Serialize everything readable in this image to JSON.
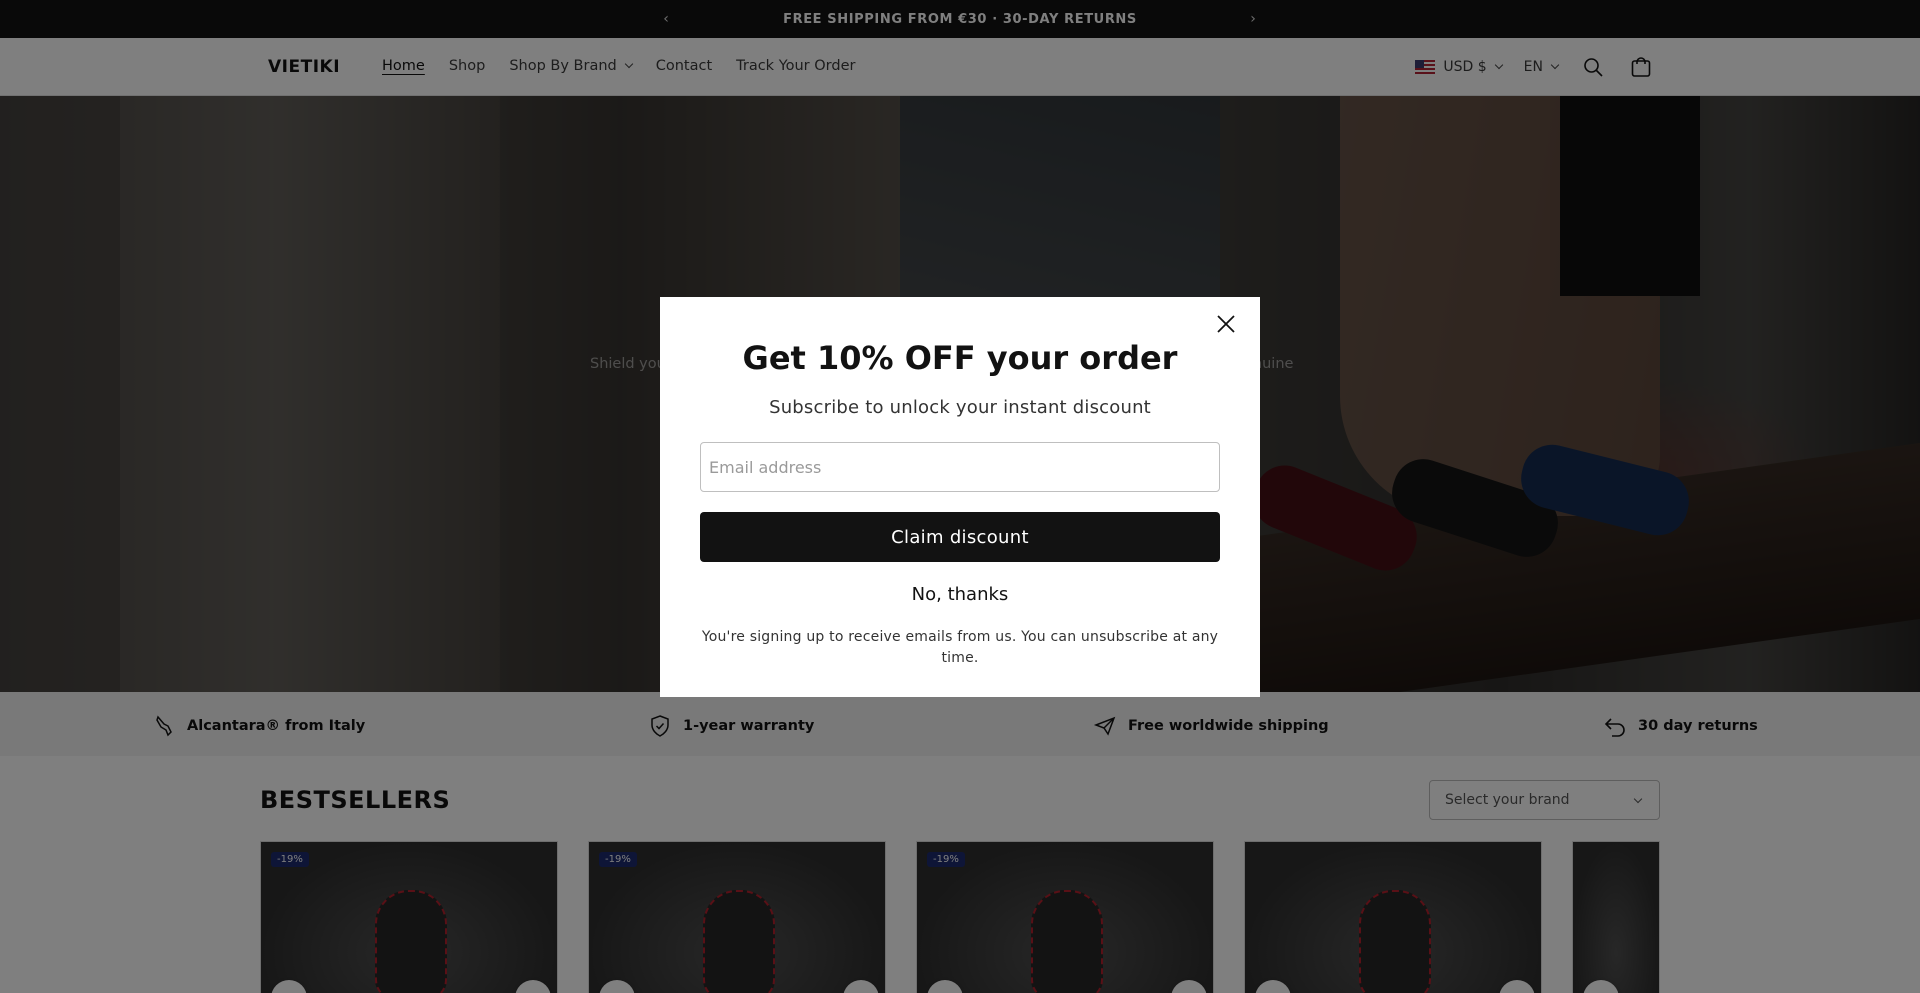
{
  "announcement": {
    "text": "FREE SHIPPING FROM €30 · 30-DAY RETURNS"
  },
  "header": {
    "logo": "VIETIKI",
    "nav": [
      "Home",
      "Shop",
      "Shop By Brand",
      "Contact",
      "Track Your Order"
    ],
    "currency": "USD $",
    "language": "EN"
  },
  "hero": {
    "text_left": "Shield you",
    "text_right": "n genuine"
  },
  "features": [
    "Alcantara® from Italy",
    "1-year warranty",
    "Free worldwide shipping",
    "30 day returns"
  ],
  "bestsellers": {
    "title": "BESTSELLERS",
    "brand_select": "Select your brand",
    "badges": [
      "-19%",
      "-19%",
      "-19%"
    ]
  },
  "modal": {
    "title": "Get 10% OFF your order",
    "subtitle": "Subscribe to unlock your instant discount",
    "email_placeholder": "Email address",
    "claim_label": "Claim discount",
    "decline_label": "No, thanks",
    "fine_print": "You're signing up to receive emails from us. You can unsubscribe at any time."
  },
  "colors": {
    "primary": "#121212",
    "badge": "#1c2a6e",
    "accent_red": "#b3202c"
  },
  "icons": [
    "chevron-left-icon",
    "chevron-right-icon",
    "us-flag-icon",
    "search-icon",
    "cart-icon",
    "close-icon",
    "italy-boot-icon",
    "shield-check-icon",
    "plane-icon",
    "return-arrow-icon"
  ]
}
